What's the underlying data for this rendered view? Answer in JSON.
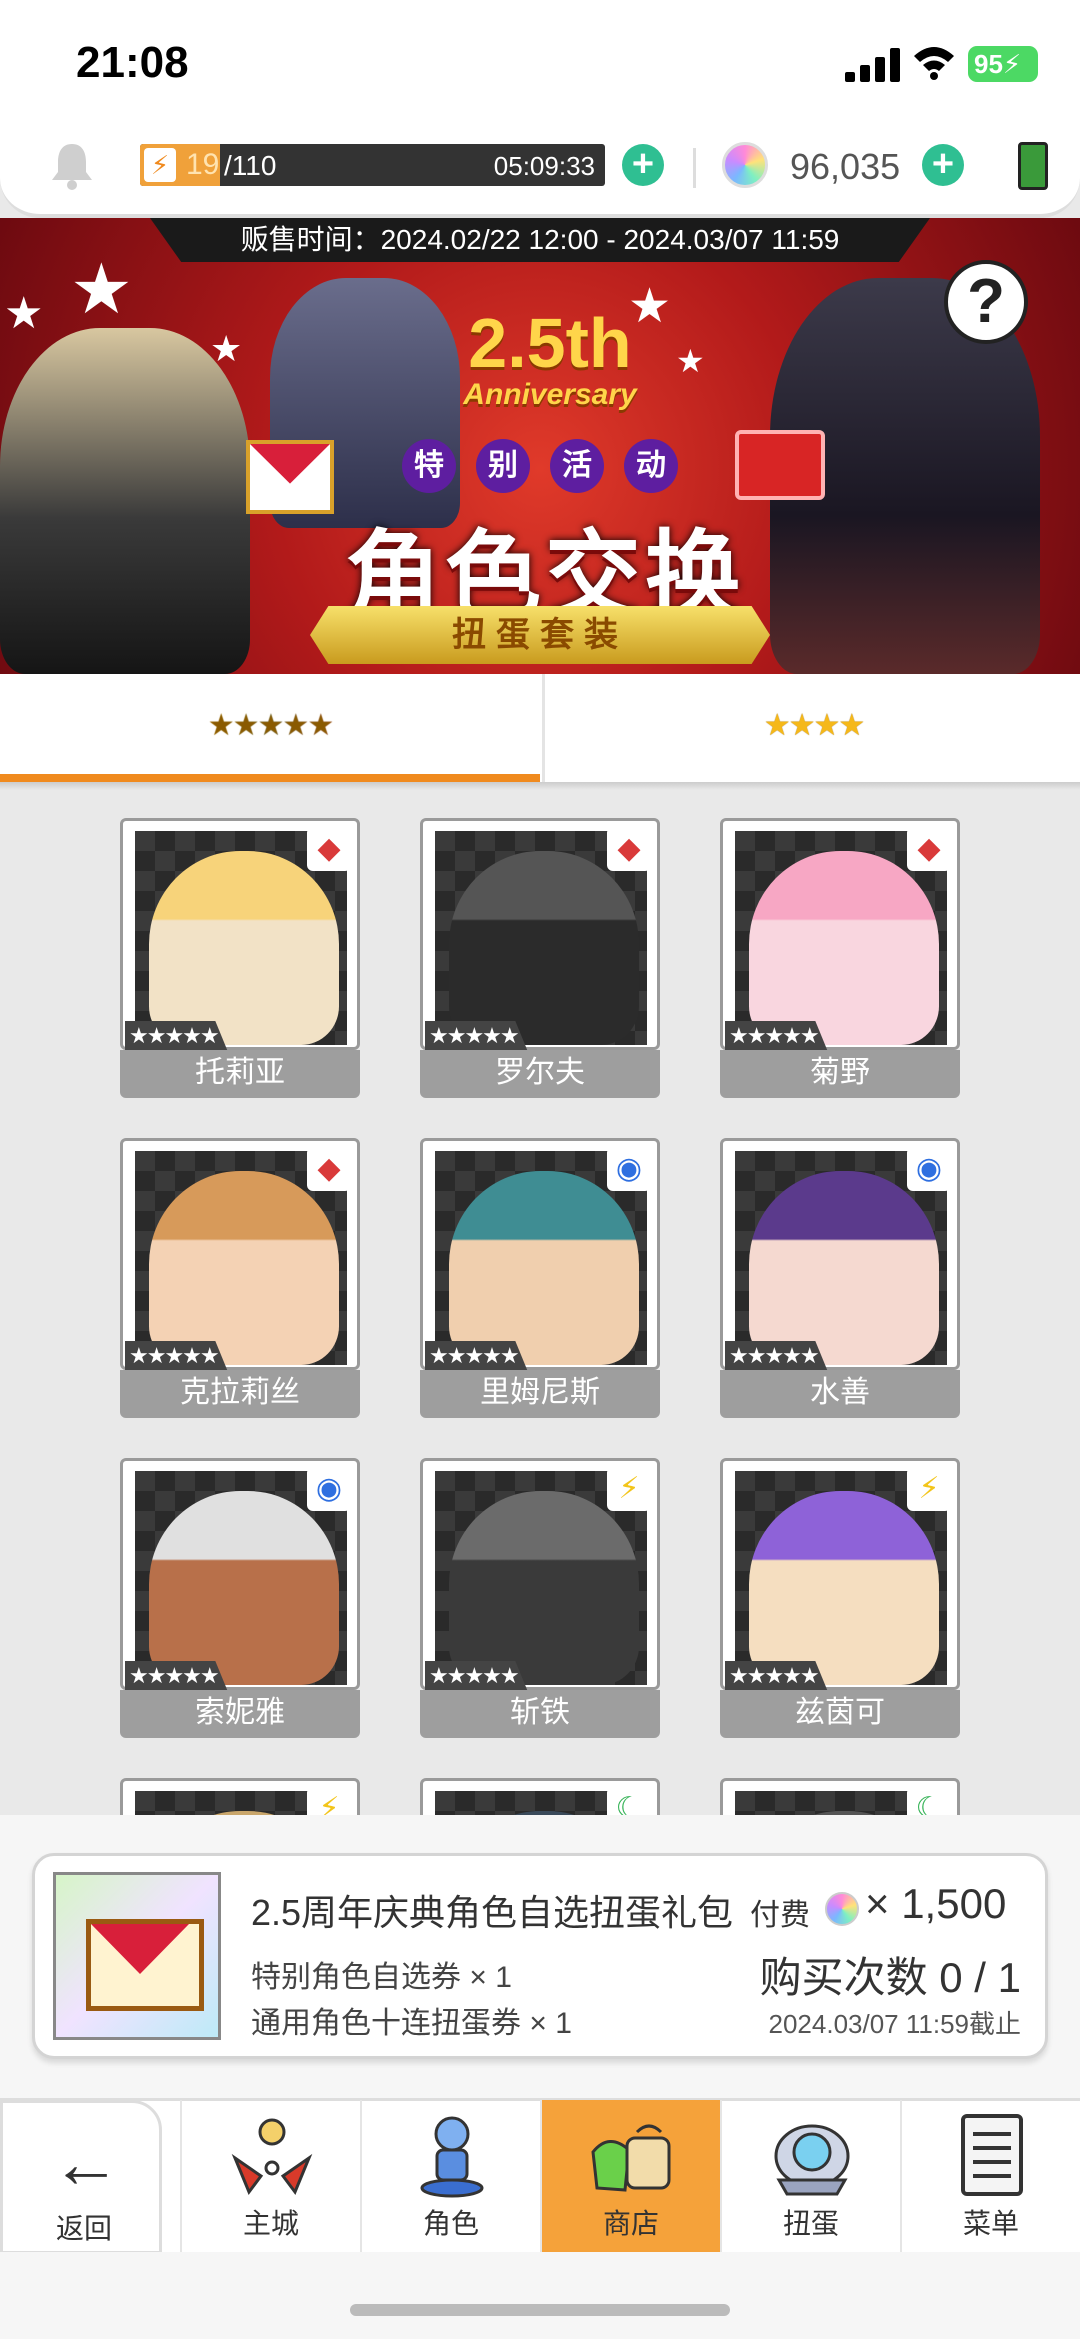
{
  "status_bar": {
    "time": "21:08",
    "battery": "95"
  },
  "resources": {
    "stamina_current": "19",
    "stamina_max": "/110",
    "stamina_fraction": 0.1727,
    "stamina_timer": "05:09:33",
    "gems": "96,035"
  },
  "banner": {
    "sale_period": "贩售时间：2024.02/22 12:00 - 2024.03/07 11:59",
    "anniversary_number": "2.5th",
    "anniversary_word": "Anniversary",
    "tag_chars": [
      "特",
      "别",
      "活",
      "动"
    ],
    "headline": "角色交换",
    "ribbon": "扭蛋套装",
    "help": "?"
  },
  "tabs": [
    {
      "label": "★★★★★"
    },
    {
      "label": "★★★★"
    }
  ],
  "characters": [
    {
      "name": "托莉亚",
      "rarity": "★★★★★",
      "element": "fire-element-icon",
      "colors": [
        "#f7d37a",
        "#f2e2c6"
      ]
    },
    {
      "name": "罗尔夫",
      "rarity": "★★★★★",
      "element": "fire-element-icon",
      "colors": [
        "#555",
        "#2b2b2b"
      ]
    },
    {
      "name": "菊野",
      "rarity": "★★★★★",
      "element": "fire-element-icon",
      "colors": [
        "#f7a7c4",
        "#f9d6df"
      ]
    },
    {
      "name": "克拉莉丝",
      "rarity": "★★★★★",
      "element": "fire-element-icon",
      "colors": [
        "#d79a5a",
        "#f4d2b4"
      ]
    },
    {
      "name": "里姆尼斯",
      "rarity": "★★★★★",
      "element": "water-element-icon",
      "colors": [
        "#3f8d93",
        "#f0cfae"
      ]
    },
    {
      "name": "水善",
      "rarity": "★★★★★",
      "element": "water-element-icon",
      "colors": [
        "#5b3a8c",
        "#f5d9d0"
      ]
    },
    {
      "name": "索妮雅",
      "rarity": "★★★★★",
      "element": "water-element-icon",
      "colors": [
        "#e0e0e0",
        "#b8704a"
      ]
    },
    {
      "name": "斩铁",
      "rarity": "★★★★★",
      "element": "thunder-element-icon",
      "colors": [
        "#6b6b6b",
        "#3a3a3a"
      ]
    },
    {
      "name": "兹茵可",
      "rarity": "★★★★★",
      "element": "thunder-element-icon",
      "colors": [
        "#8e62d8",
        "#f5dec0"
      ]
    },
    {
      "name": "",
      "rarity": "",
      "element": "thunder-element-icon",
      "colors": [
        "#c9a66b",
        "#7a6a4a"
      ]
    },
    {
      "name": "",
      "rarity": "",
      "element": "wind-element-icon",
      "colors": [
        "#3a4a5a",
        "#2a2a2a"
      ]
    },
    {
      "name": "",
      "rarity": "",
      "element": "wind-element-icon",
      "colors": [
        "#555",
        "#cfcfcf"
      ]
    }
  ],
  "offer": {
    "title": "2.5周年庆典角色自选扭蛋礼包",
    "paid_label": "付费",
    "price": "× 1,500",
    "line1": "特别角色自选券 × 1",
    "line2": "通用角色十连扭蛋券 × 1",
    "purchase_count": "购买次数 0 / 1",
    "deadline": "2024.03/07 11:59截止"
  },
  "nav": {
    "back": "返回",
    "items": [
      "主城",
      "角色",
      "商店",
      "扭蛋",
      "菜单"
    ]
  },
  "colors": {
    "accent": "#f08a1e",
    "plus": "#2fbf92",
    "nav_active": "#f5a23a"
  }
}
